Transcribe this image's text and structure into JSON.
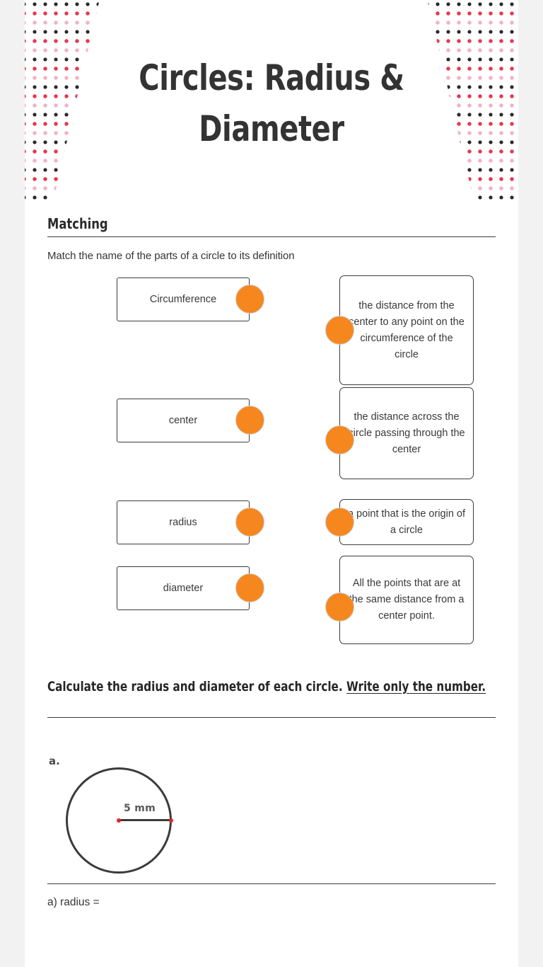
{
  "header": {
    "title": "Circles: Radius &\nDiameter",
    "decoration": {
      "left_pattern": "dot-grid-pattern",
      "right_pattern": "dot-grid-pattern",
      "dot_colors": [
        "#2b2b2b",
        "#e8384f",
        "#f2b2c2"
      ]
    }
  },
  "matching_section": {
    "heading": "Matching",
    "instruction": "Match the name of the parts of a circle to its definition",
    "pairs": [
      {
        "term": "Circumference",
        "definition": "the distance from the center to any point on the circumference of the circle"
      },
      {
        "term": "center",
        "definition": "the distance across the circle passing through the center"
      },
      {
        "term": "radius",
        "definition": "a point that is the origin of a circle"
      },
      {
        "term": "diameter",
        "definition": "All the points that are at the same distance from a center point."
      }
    ],
    "connector_color": "#f6871f"
  },
  "calculate_section": {
    "prompt": "Calculate the radius and diameter of each circle.",
    "prompt_emphasis": "Write only the number.",
    "problems": [
      {
        "label": "a.",
        "figure": {
          "type": "circle",
          "measurement_label": "5 mm",
          "measurement_type": "radius",
          "measurement_value": 5,
          "units": "mm",
          "endpoint_color": "#e8202a",
          "stroke_color": "#3b3b3b"
        },
        "answer_line": "a) radius ="
      }
    ]
  }
}
